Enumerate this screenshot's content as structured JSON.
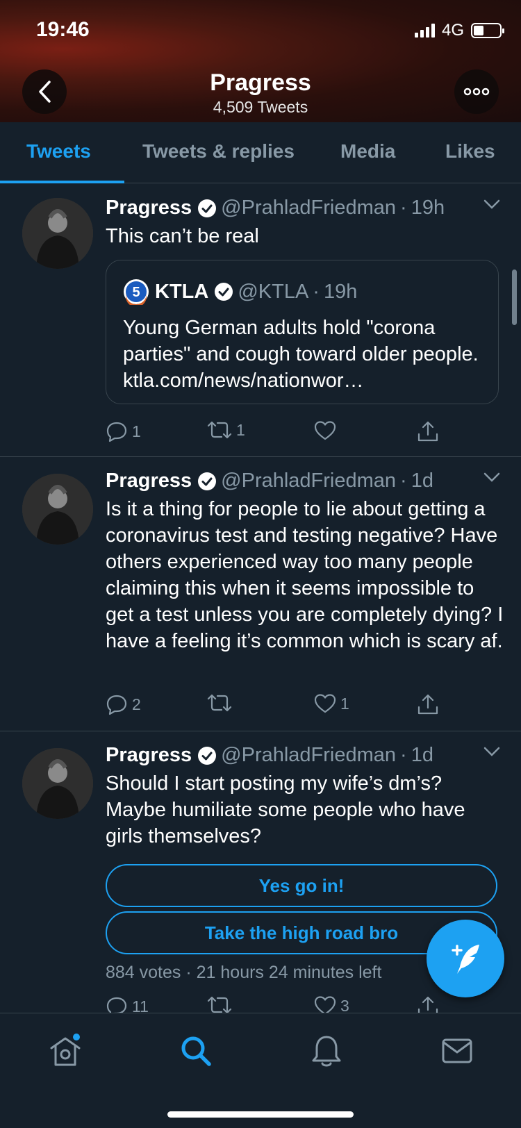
{
  "status_bar": {
    "time": "19:46",
    "network": "4G"
  },
  "header": {
    "title": "Pragress",
    "subtitle": "4,509 Tweets"
  },
  "tabs": [
    {
      "label": "Tweets",
      "active": true
    },
    {
      "label": "Tweets & replies",
      "active": false
    },
    {
      "label": "Media",
      "active": false
    },
    {
      "label": "Likes",
      "active": false
    }
  ],
  "tweets": [
    {
      "name": "Pragress",
      "handle": "@PrahladFriedman",
      "time": "19h",
      "text": "This can’t be real",
      "quote": {
        "name": "KTLA",
        "handle": "@KTLA",
        "time": "19h",
        "text": "Young German adults hold \"corona parties\" and cough toward older people. ktla.com/news/nationwor…"
      },
      "replies": "1",
      "retweets": "1",
      "likes": ""
    },
    {
      "name": "Pragress",
      "handle": "@PrahladFriedman",
      "time": "1d",
      "text": "Is it a thing for people to lie about getting a coronavirus test and testing negative? Have others experienced way too many people claiming this when it seems impossible to get a test unless you are completely dying? I have a feeling it’s common which is scary af.",
      "replies": "2",
      "retweets": "",
      "likes": "1"
    },
    {
      "name": "Pragress",
      "handle": "@PrahladFriedman",
      "time": "1d",
      "text": "Should I start posting my wife’s dm’s? Maybe humiliate some people who have girls themselves?",
      "poll": {
        "options": [
          "Yes go in!",
          "Take the high road bro"
        ],
        "meta": "884 votes · 21 hours 24 minutes left"
      },
      "replies": "11",
      "retweets": "",
      "likes": "3"
    }
  ],
  "colors": {
    "accent": "#1da1f2",
    "background": "#15202b",
    "muted": "#8899a6",
    "border": "#38444d"
  },
  "icons": {
    "nav": [
      "home-icon",
      "search-icon",
      "notifications-icon",
      "messages-icon"
    ],
    "fab": "compose-tweet-icon"
  }
}
